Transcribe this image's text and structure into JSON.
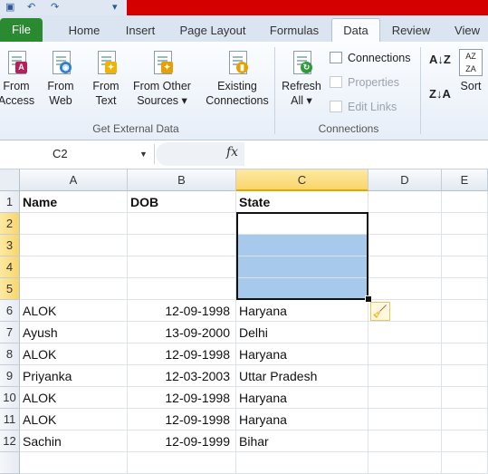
{
  "colors": {
    "file_tab": "#2a8a30",
    "selection_fill": "#a6c9ec",
    "header_selected": "#f9d66a",
    "title_red": "#d40000"
  },
  "tabs": [
    {
      "label": "File"
    },
    {
      "label": "Home"
    },
    {
      "label": "Insert"
    },
    {
      "label": "Page Layout"
    },
    {
      "label": "Formulas"
    },
    {
      "label": "Data"
    },
    {
      "label": "Review"
    },
    {
      "label": "View"
    }
  ],
  "active_tab": "Data",
  "ribbon": {
    "get_external_data": {
      "label": "Get External Data",
      "buttons": [
        {
          "line1": "From",
          "line2": "Access",
          "icon": "access-icon"
        },
        {
          "line1": "From",
          "line2": "Web",
          "icon": "web-icon"
        },
        {
          "line1": "From",
          "line2": "Text",
          "icon": "text-file-icon"
        },
        {
          "line1": "From Other",
          "line2": "Sources ▾",
          "icon": "other-sources-icon"
        },
        {
          "line1": "Existing",
          "line2": "Connections",
          "icon": "existing-connections-icon"
        }
      ]
    },
    "connections": {
      "label": "Connections",
      "refresh": {
        "line1": "Refresh",
        "line2": "All ▾"
      },
      "items": [
        {
          "label": "Connections",
          "enabled": true
        },
        {
          "label": "Properties",
          "enabled": false
        },
        {
          "label": "Edit Links",
          "enabled": false
        }
      ]
    },
    "sort": {
      "label": "Sort"
    }
  },
  "formula_bar": {
    "name_box": "C2",
    "fx": "fx",
    "formula": ""
  },
  "columns": [
    "A",
    "B",
    "C",
    "D",
    "E"
  ],
  "selected_column": "C",
  "rows": [
    {
      "num": "1",
      "a": "Name",
      "b": "DOB",
      "c": "State"
    },
    {
      "num": "2",
      "a": "",
      "b": "",
      "c": ""
    },
    {
      "num": "3",
      "a": "",
      "b": "",
      "c": ""
    },
    {
      "num": "4",
      "a": "",
      "b": "",
      "c": ""
    },
    {
      "num": "5",
      "a": "",
      "b": "",
      "c": ""
    },
    {
      "num": "6",
      "a": "ALOK",
      "b": "12-09-1998",
      "c": "Haryana"
    },
    {
      "num": "7",
      "a": "Ayush",
      "b": "13-09-2000",
      "c": "Delhi"
    },
    {
      "num": "8",
      "a": "ALOK",
      "b": "12-09-1998",
      "c": "Haryana"
    },
    {
      "num": "9",
      "a": "Priyanka",
      "b": "12-03-2003",
      "c": "Uttar Pradesh"
    },
    {
      "num": "10",
      "a": "ALOK",
      "b": "12-09-1998",
      "c": "Haryana"
    },
    {
      "num": "11",
      "a": "ALOK",
      "b": "12-09-1998",
      "c": "Haryana"
    },
    {
      "num": "12",
      "a": "Sachin",
      "b": "12-09-1999",
      "c": "Bihar"
    },
    {
      "num": "",
      "a": "",
      "b": "",
      "c": ""
    }
  ]
}
